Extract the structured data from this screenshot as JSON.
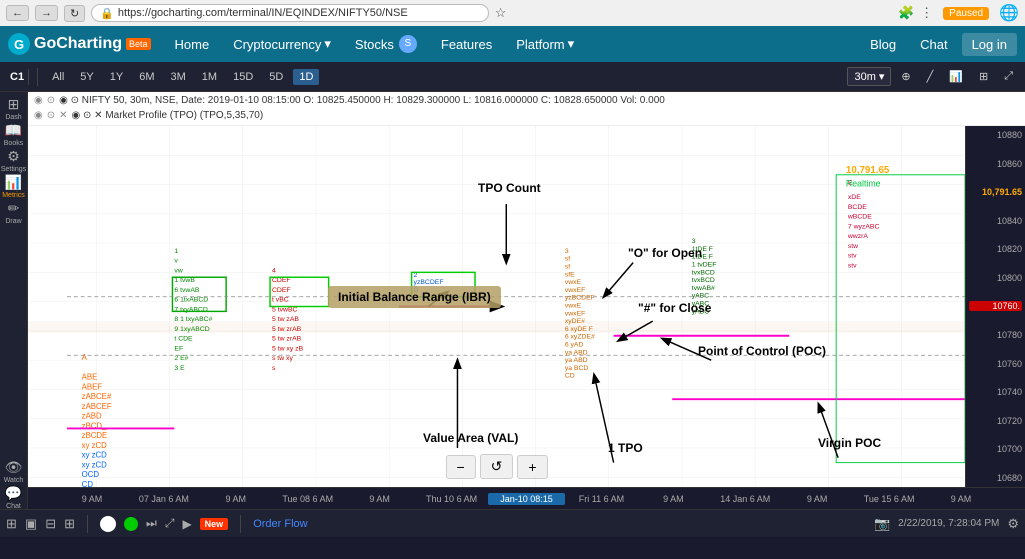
{
  "browser": {
    "url": "https://gocharting.com/terminal/IN/EQINDEX/NIFTY50/NSE",
    "status": "Paused"
  },
  "nav": {
    "logo": "GoCharting",
    "beta": "Beta",
    "items": [
      "Home",
      "Cryptocurrency",
      "Stocks",
      "Features",
      "Platform"
    ],
    "right_items": [
      "Blog",
      "Chat",
      "Log in"
    ]
  },
  "toolbar": {
    "symbol": "C1",
    "timeframes": [
      "All",
      "5Y",
      "1Y",
      "6M",
      "3M",
      "1M",
      "15D",
      "5D",
      "1D"
    ],
    "selected_tf": "1D",
    "interval": "30m",
    "zoom_controls": [
      "−",
      "↺",
      "+"
    ]
  },
  "chart_info": {
    "line1": "◉ ⊙  NIFTY 50, 30m, NSE, Date: 2019-01-10 08:15:00  O: 10825.450000  H: 10829.300000  L: 10816.000000  C: 10828.650000  Vol: 0.000",
    "line2": "◉ ⊙ ✕  Market Profile (TPO) (TPO,5,35,70)"
  },
  "annotations": {
    "tpo_count": "TPO Count",
    "o_for_open": "\"O\" for Open",
    "hash_for_close": "\"#\" for Close",
    "poc": "Point of Control (POC)",
    "ibr": "Initial Balance Range (IBR)",
    "val": "Value Area (VAL)",
    "one_tpo": "1 TPO",
    "virgin_poc": "Virgin POC"
  },
  "price_levels": [
    "10880",
    "10860",
    "10840",
    "10820",
    "10800",
    "10780",
    "10760",
    "10740",
    "10720",
    "10700",
    "10680"
  ],
  "realtime_price": "10,791.65",
  "current_price_red": "10760.",
  "time_labels": [
    "9 AM",
    "07 Jan  6 AM",
    "9 AM",
    "Tue 08  6 AM",
    "9 AM",
    "Thu 10  6 AM",
    "Jan-10 08:15",
    "Fri 11  6 AM",
    "9 AM",
    "14 Jan  6 AM",
    "9 AM",
    "Tue 15  6 AM",
    "9 AM"
  ],
  "bottom_bar": {
    "order_flow": "Order Flow",
    "datetime": "2/22/2019, 7:28:04 PM"
  },
  "sidebar_items": [
    {
      "id": "dash",
      "symbol": "⊞",
      "label": "Dash"
    },
    {
      "id": "books",
      "symbol": "📚",
      "label": "Books"
    },
    {
      "id": "settings",
      "symbol": "⚙",
      "label": "Settings"
    },
    {
      "id": "metrics",
      "symbol": "📊",
      "label": "Metrics"
    },
    {
      "id": "draw",
      "symbol": "✏",
      "label": "Draw"
    },
    {
      "id": "watch",
      "symbol": "👁",
      "label": "Watch"
    },
    {
      "id": "chat",
      "symbol": "💬",
      "label": "Chat"
    }
  ]
}
